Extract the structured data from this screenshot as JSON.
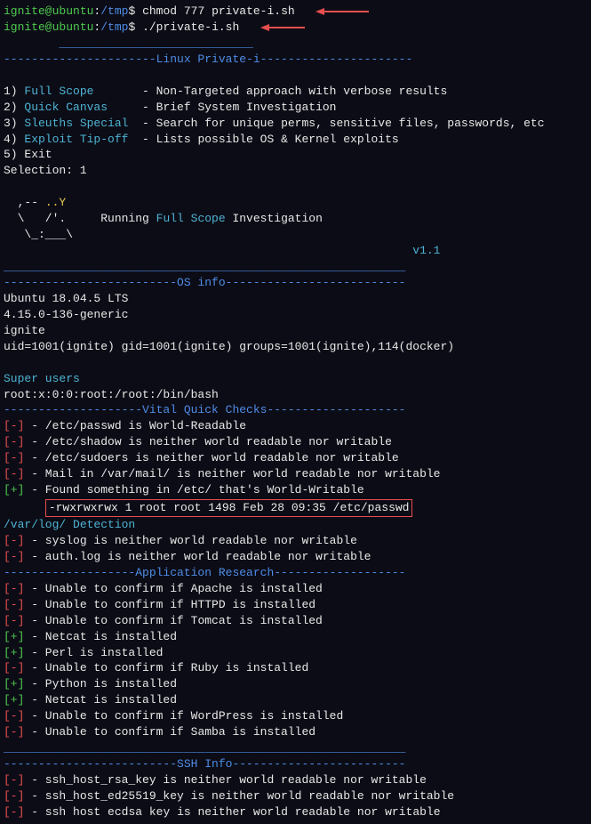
{
  "prompt1": {
    "user": "ignite@ubuntu",
    "sep": ":",
    "path": "/tmp",
    "dollar": "$ ",
    "cmd": "chmod 777 private-i.sh"
  },
  "prompt2": {
    "user": "ignite@ubuntu",
    "sep": ":",
    "path": "/tmp",
    "dollar": "$ ",
    "cmd": "./private-i.sh"
  },
  "hdr_top": "        ____________________________",
  "hdr_mid": "----------------------Linux Private-i----------------------",
  "menu": {
    "i1n": "1) ",
    "i1l": "Full Scope",
    "i1d": "       - Non-Targeted approach with verbose results",
    "i2n": "2) ",
    "i2l": "Quick Canvas",
    "i2d": "     - Brief System Investigation",
    "i3n": "3) ",
    "i3l": "Sleuths Special",
    "i3d": "  - Search for unique perms, sensitive files, passwords, etc",
    "i4n": "4) ",
    "i4l": "Exploit Tip-off",
    "i4d": "  - Lists possible OS & Kernel exploits",
    "i5n": "5) Exit"
  },
  "selection": "Selection: 1",
  "ascii1": "  ,-- ",
  "ascii1y": "..Y",
  "ascii2a": "  \\   /'.     Running ",
  "ascii2b": "Full Scope",
  "ascii2c": " Investigation",
  "ascii3": "   \\_:___\\",
  "version": "                                                           v1.1",
  "dash58": "__________________________________________________________",
  "hdr_os": "-------------------------OS info--------------------------",
  "os": {
    "l1": "Ubuntu 18.04.5 LTS",
    "l2": "4.15.0-136-generic",
    "l3": "ignite",
    "l4": "uid=1001(ignite) gid=1001(ignite) groups=1001(ignite),114(docker)"
  },
  "super_label": "Super users",
  "super_line": "root:x:0:0:root:/root:/bin/bash",
  "hdr_vital": "--------------------Vital Quick Checks--------------------",
  "v": {
    "neg": "[-]",
    "pos": "[+]",
    "c1": " - /etc/passwd is World-Readable",
    "c2": " - /etc/shadow is neither world readable nor writable",
    "c3": " - /etc/sudoers is neither world readable nor writable",
    "c4": " - Mail in /var/mail/ is neither world readable nor writable",
    "c5": " - Found something in /etc/ that's World-Writable",
    "box": "-rwxrwxrwx 1 root root 1498 Feb 28 09:35 /etc/passwd"
  },
  "varlog": "/var/log/ Detection",
  "vl1": " - syslog is neither world readable nor writable",
  "vl2": " - auth.log is neither world readable nor writable",
  "hdr_app": "-------------------Application Research-------------------",
  "a": {
    "l1": " - Unable to confirm if Apache is installed",
    "l2": " - Unable to confirm if HTTPD is installed",
    "l3": " - Unable to confirm if Tomcat is installed",
    "l4": " - Netcat is installed",
    "l5": " - Perl is installed",
    "l6": " - Unable to confirm if Ruby is installed",
    "l7": " - Python is installed",
    "l8": " - Netcat is installed",
    "l9": " - Unable to confirm if WordPress is installed",
    "l10": " - Unable to confirm if Samba is installed"
  },
  "hdr_ssh": "-------------------------SSH Info-------------------------",
  "s": {
    "l1": " - ssh_host_rsa_key is neither world readable nor writable",
    "l2": " - ssh_host_ed25519_key is neither world readable nor writable",
    "l3a": " - ssh host",
    "l3b": "ecdsa",
    "l3c": "key is neither world readable nor writable"
  }
}
